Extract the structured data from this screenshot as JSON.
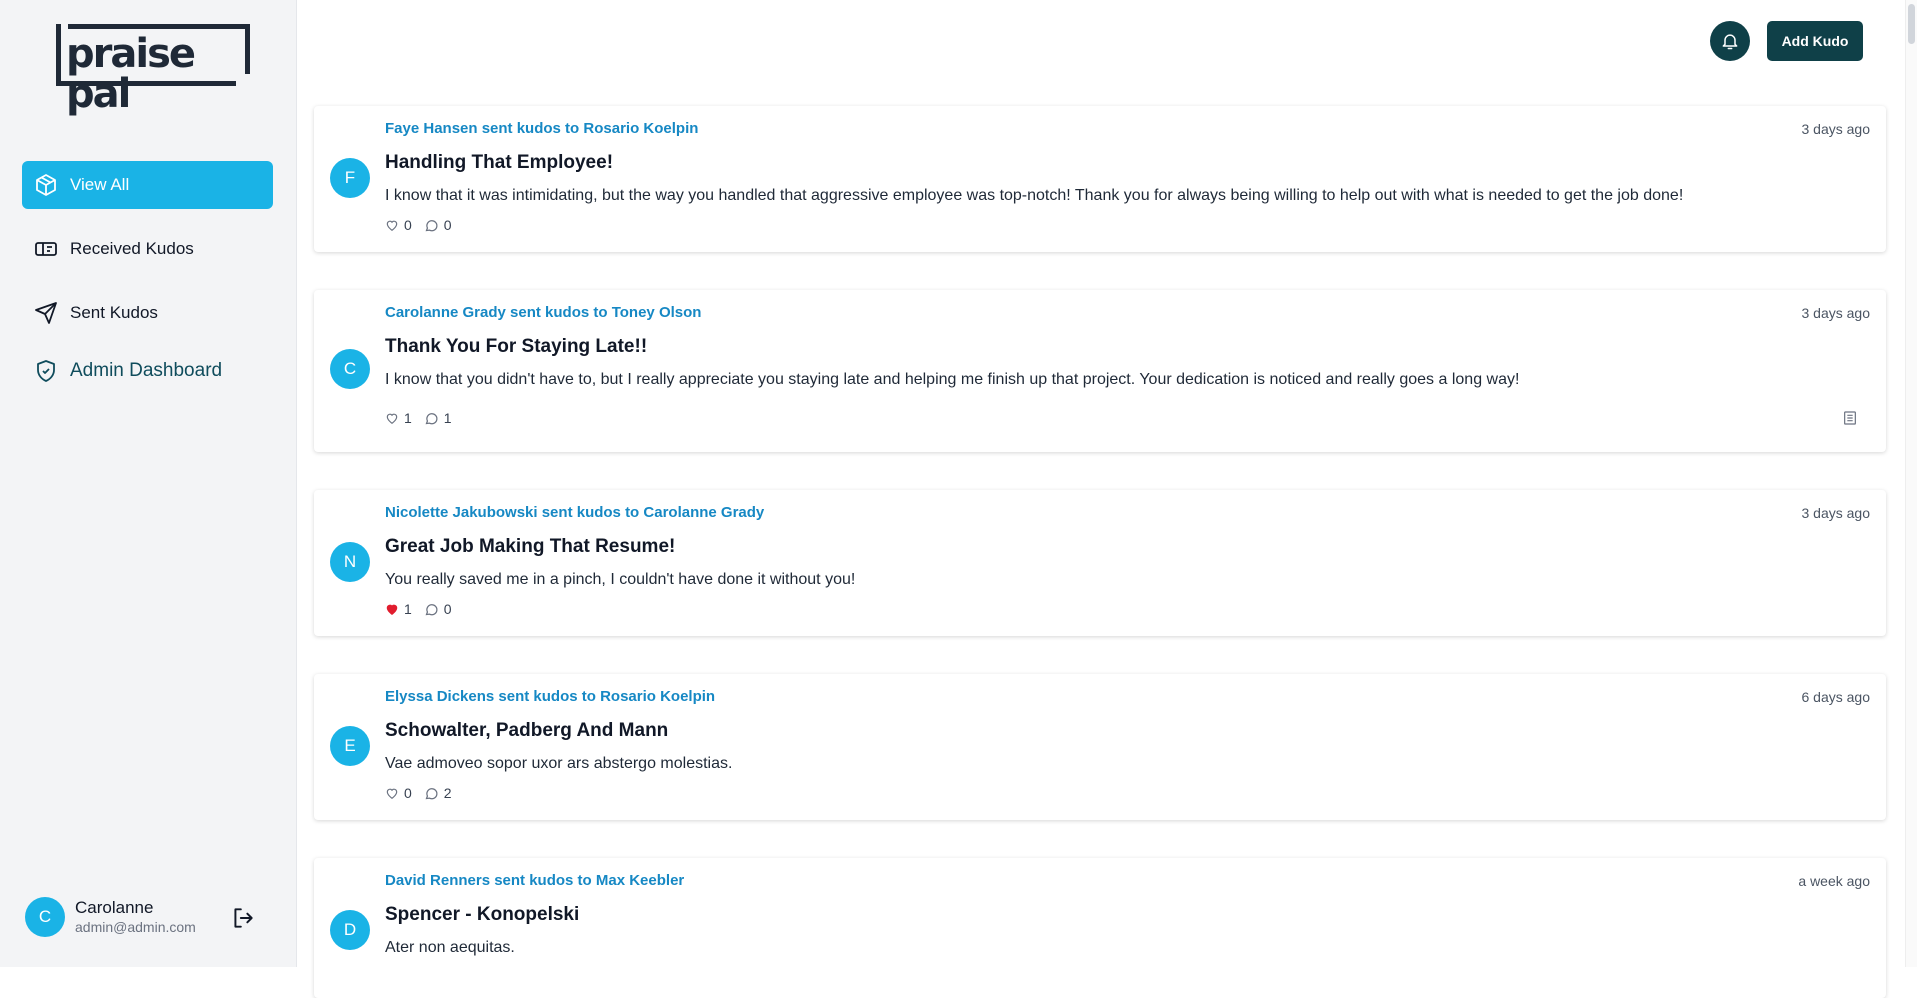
{
  "brand": {
    "logo_text": "praise pal"
  },
  "sidebar": {
    "items": [
      {
        "label": "View All",
        "icon": "box-icon"
      },
      {
        "label": "Received Kudos",
        "icon": "ticket-icon"
      },
      {
        "label": "Sent Kudos",
        "icon": "send-icon"
      },
      {
        "label": "Admin Dashboard",
        "icon": "shield-icon"
      }
    ],
    "user": {
      "initial": "C",
      "name": "Carolanne",
      "email": "admin@admin.com"
    }
  },
  "header": {
    "add_label": "Add Kudo"
  },
  "feed": [
    {
      "initial": "F",
      "header": "Faye Hansen sent kudos to Rosario Koelpin",
      "time": "3 days ago",
      "title": "Handling That Employee!",
      "body": "I know that it was intimidating, but the way you handled that aggressive employee was top-notch! Thank you for always being willing to help out with what is needed to get the job done!",
      "likes": "0",
      "comments": "0"
    },
    {
      "initial": "C",
      "header": "Carolanne Grady sent kudos to Toney Olson",
      "time": "3 days ago",
      "title": "Thank You For Staying Late!!",
      "body": "I know that you didn't have to, but I really appreciate you staying late and helping me finish up that project. Your dedication is noticed and really goes a long way!",
      "likes": "1",
      "comments": "1"
    },
    {
      "initial": "N",
      "header": "Nicolette Jakubowski sent kudos to Carolanne Grady",
      "time": "3 days ago",
      "title": "Great Job Making That Resume!",
      "body": "You really saved me in a pinch, I couldn't have done it without you!",
      "likes": "1",
      "comments": "0"
    },
    {
      "initial": "E",
      "header": "Elyssa Dickens sent kudos to Rosario Koelpin",
      "time": "6 days ago",
      "title": "Schowalter, Padberg And Mann",
      "body": "Vae admoveo sopor uxor ars abstergo molestias.",
      "likes": "0",
      "comments": "2"
    },
    {
      "initial": "D",
      "header": "David Renners sent kudos to Max Keebler",
      "time": "a week ago",
      "title": "Spencer - Konopelski",
      "body": "Ater non aequitas.",
      "likes": "",
      "comments": ""
    }
  ],
  "colors": {
    "accent": "#1ab3e6",
    "dark": "#0f4048",
    "link": "#1688c4",
    "liked": "#e11d2e"
  }
}
